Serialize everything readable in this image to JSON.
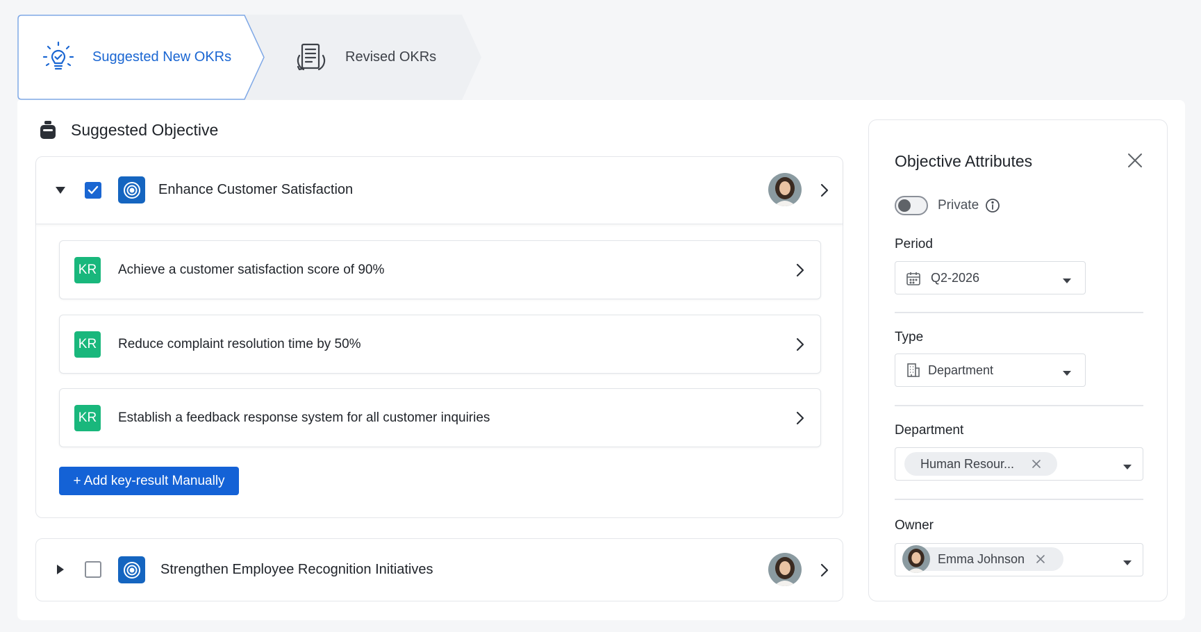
{
  "tabs": [
    {
      "label": "Suggested New OKRs",
      "active": true,
      "icon": "lightbulb-icon"
    },
    {
      "label": "Revised OKRs",
      "active": false,
      "icon": "document-revise-icon"
    }
  ],
  "section": {
    "title": "Suggested Objective",
    "icon": "robot-icon"
  },
  "objectives": [
    {
      "title": "Enhance Customer Satisfaction",
      "expanded": true,
      "checked": true,
      "key_results": [
        {
          "badge": "KR",
          "text": "Achieve a customer satisfaction score of 90%"
        },
        {
          "badge": "KR",
          "text": "Reduce complaint resolution time by 50%"
        },
        {
          "badge": "KR",
          "text": "Establish a feedback response system for all customer inquiries"
        }
      ],
      "add_button_label": "+ Add key-result Manually"
    },
    {
      "title": "Strengthen Employee Recognition Initiatives",
      "expanded": false,
      "checked": false
    }
  ],
  "attributes": {
    "title": "Objective Attributes",
    "private": {
      "label": "Private",
      "enabled": false
    },
    "period": {
      "label": "Period",
      "value": "Q2-2026"
    },
    "type": {
      "label": "Type",
      "value": "Department"
    },
    "department": {
      "label": "Department",
      "value": "Human Resour..."
    },
    "owner": {
      "label": "Owner",
      "value": "Emma Johnson"
    }
  },
  "colors": {
    "accent": "#1a66d2",
    "kr_badge": "#19b77c",
    "target_icon_bg": "#1565c0",
    "button_bg": "#1462d6"
  }
}
